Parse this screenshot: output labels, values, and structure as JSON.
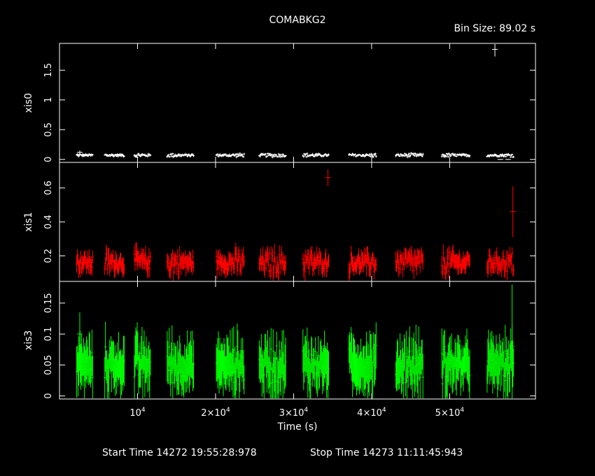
{
  "title": "COMABKG2",
  "bin_size": "Bin Size: 89.02 s",
  "xlabel": "Time (s)",
  "start_time": "Start Time 14272 19:55:28:978",
  "stop_time": "Stop Time 14273 11:11:45:943",
  "x_tick_labels": [
    {
      "base": "10",
      "exp": "4",
      "value": 10000
    },
    {
      "base": "2×10",
      "exp": "4",
      "value": 20000
    },
    {
      "base": "3×10",
      "exp": "4",
      "value": 30000
    },
    {
      "base": "4×10",
      "exp": "4",
      "value": 40000
    },
    {
      "base": "5×10",
      "exp": "4",
      "value": 50000
    }
  ],
  "chart_data": {
    "type": "scatter",
    "x_range": [
      0,
      61000
    ],
    "segments": [
      [
        2200,
        4300
      ],
      [
        5800,
        8300
      ],
      [
        9600,
        11700
      ],
      [
        13800,
        17200
      ],
      [
        20100,
        23700
      ],
      [
        25600,
        29000
      ],
      [
        31200,
        34500
      ],
      [
        37100,
        40600
      ],
      [
        43100,
        46600
      ],
      [
        49000,
        52600
      ],
      [
        54800,
        58200
      ]
    ],
    "panels": [
      {
        "ylabel": "xis0",
        "color": "#ffffff",
        "ylim": [
          -0.05,
          1.95
        ],
        "yticks": [
          0,
          0.5,
          1,
          1.5
        ],
        "ytick_labels": [
          "0",
          "0.5",
          "1",
          "1.5"
        ],
        "typical_level": 0.07,
        "noise": 0.025,
        "error": 0.02,
        "sparse_points": [
          [
            2600,
            0.12,
            0.03
          ],
          [
            55800,
            1.85,
            0.12
          ],
          [
            56500,
            0,
            0.005
          ],
          [
            57500,
            0,
            0.005
          ]
        ]
      },
      {
        "ylabel": "xis1",
        "color": "#ff0000",
        "ylim": [
          0.05,
          0.75
        ],
        "yticks": [
          0.2,
          0.4,
          0.6
        ],
        "ytick_labels": [
          "0.2",
          "0.4",
          "0.6"
        ],
        "typical_level": 0.16,
        "noise": 0.05,
        "error": 0.05,
        "sparse_points": [
          [
            2600,
            0.16,
            0.03
          ],
          [
            34400,
            0.66,
            0.05
          ],
          [
            58100,
            0.46,
            0.15
          ]
        ]
      },
      {
        "ylabel": "xis3",
        "color": "#00ff00",
        "ylim": [
          -0.005,
          0.185
        ],
        "yticks": [
          0,
          0.05,
          0.1,
          0.15
        ],
        "ytick_labels": [
          "0",
          "0.05",
          "0.1",
          "0.15"
        ],
        "typical_level": 0.05,
        "noise": 0.025,
        "error": 0.035,
        "sparse_points": [
          [
            2600,
            0.1,
            0.035
          ],
          [
            58000,
            0.08,
            0.1
          ]
        ]
      }
    ]
  }
}
